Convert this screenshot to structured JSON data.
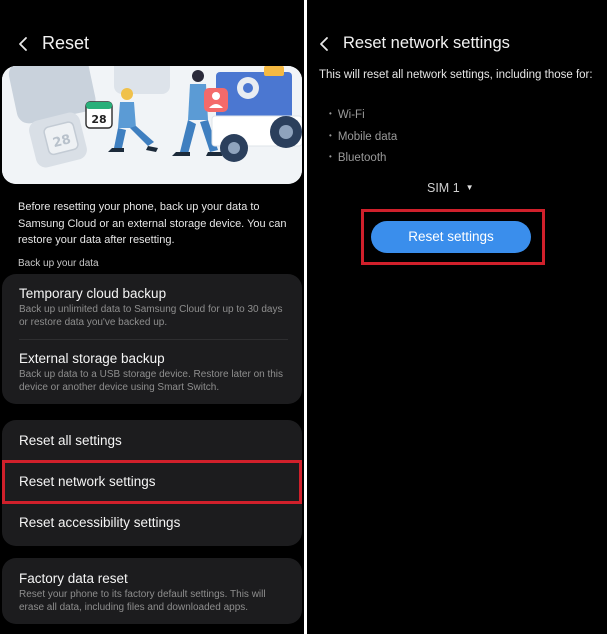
{
  "left": {
    "header": {
      "title": "Reset"
    },
    "illustration": {
      "calendar_date": "28",
      "calendar_date_faded": "28"
    },
    "intro": "Before resetting your phone, back up your data to Samsung Cloud or an external storage device. You can restore your data after resetting.",
    "backup_label": "Back up your data",
    "backup_items": [
      {
        "title": "Temporary cloud backup",
        "desc": "Back up unlimited data to Samsung Cloud for up to 30 days or restore data you've backed up."
      },
      {
        "title": "External storage backup",
        "desc": "Back up data to a USB storage device. Restore later on this device or another device using Smart Switch."
      }
    ],
    "reset_items": [
      {
        "title": "Reset all settings"
      },
      {
        "title": "Reset network settings"
      },
      {
        "title": "Reset accessibility settings"
      }
    ],
    "factory": {
      "title": "Factory data reset",
      "desc": "Reset your phone to its factory default settings. This will erase all data, including files and downloaded apps."
    }
  },
  "right": {
    "header": {
      "title": "Reset network settings"
    },
    "description": "This will reset all network settings, including those for:",
    "bullets": [
      "Wi-Fi",
      "Mobile data",
      "Bluetooth"
    ],
    "sim": "SIM 1",
    "button": "Reset settings"
  },
  "colors": {
    "background": "#000000",
    "card": "#1c1c1e",
    "accent_button": "#3a8eec",
    "highlight_box": "#d0202b"
  },
  "icons": {
    "back": "chevron-left-icon",
    "dropdown": "caret-down-icon"
  }
}
